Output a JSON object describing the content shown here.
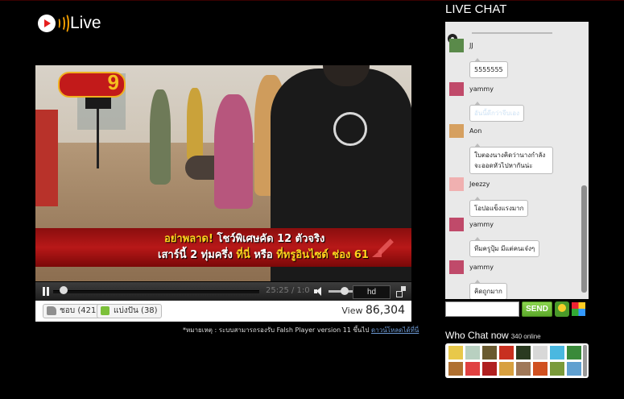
{
  "app": {
    "logo_text": "Live"
  },
  "video": {
    "ticker_line1_a": "อย่าพลาด!",
    "ticker_line1_b": " โชว์พิเศษคัด 12 ตัวจริง",
    "ticker_line2_a": "เสาร์นี้ 2 ทุ่มครึ่ง ",
    "ticker_line2_b": "ที่นี่",
    "ticker_line2_c": " หรือ ",
    "ticker_line2_d": "ที่ทรูอินไซด์ ช่อง 61",
    "channel_number": "9"
  },
  "player": {
    "time": "25:25 / 1:0",
    "quality_label": "hd",
    "progress_fraction": 0.05
  },
  "share_bar": {
    "like_label": "ชอบ (421)",
    "share_label": "แบ่งปัน (38)",
    "view_label": "View",
    "view_count": "86,304"
  },
  "notice": {
    "text": "*หมายเหตุ : ระบบสามารถรองรับ Falsh Player version 11 ขึ้นไป",
    "link": "ดาวน์โหลดได้ที่นี่"
  },
  "chat": {
    "title": "LIVE CHAT",
    "messages": [
      {
        "user": "JJ",
        "text": "5555555",
        "avatar_color": "#5a8a4a"
      },
      {
        "user": "yammy",
        "text": "อันนี้ดีกว่าจีบเอง",
        "avatar_color": "#c04a6a"
      },
      {
        "user": "Aon",
        "text": "ใบตองนางคิดว่านางกำลัง จะออดหัวไปหากันน่ะ",
        "avatar_color": "#d6a060"
      },
      {
        "user": "Jeezzy",
        "text": "โอปอแข็งแรงมาก",
        "avatar_color": "#f0b0b0"
      },
      {
        "user": "yammy",
        "text": "ทีมครูปุ้ม มีแต่คนเจ๋งๆ",
        "avatar_color": "#c04a6a"
      },
      {
        "user": "yammy",
        "text": "คิดถูกมาก",
        "avatar_color": "#c04a6a"
      }
    ],
    "send_label": "SEND"
  },
  "who_chat": {
    "title": "Who Chat now",
    "online": "340 online",
    "avatar_colors": [
      "#e8c84a",
      "#b8d0c0",
      "#6a5a30",
      "#c83020",
      "#2a3a20",
      "#d8d8d8",
      "#4ab8e0",
      "#3a8a3a",
      "#b07030",
      "#e04040",
      "#b02020",
      "#d8a040",
      "#a07858",
      "#d05020",
      "#7a9a3a",
      "#60a0d0",
      "#8a3a8a",
      "#3a3a3a",
      "#c0a060",
      "#2a5a9a"
    ]
  },
  "colors": {
    "accent_green": "#5ca82b",
    "banner_red": "#b81818",
    "ticker_yellow": "#ffd21e"
  }
}
